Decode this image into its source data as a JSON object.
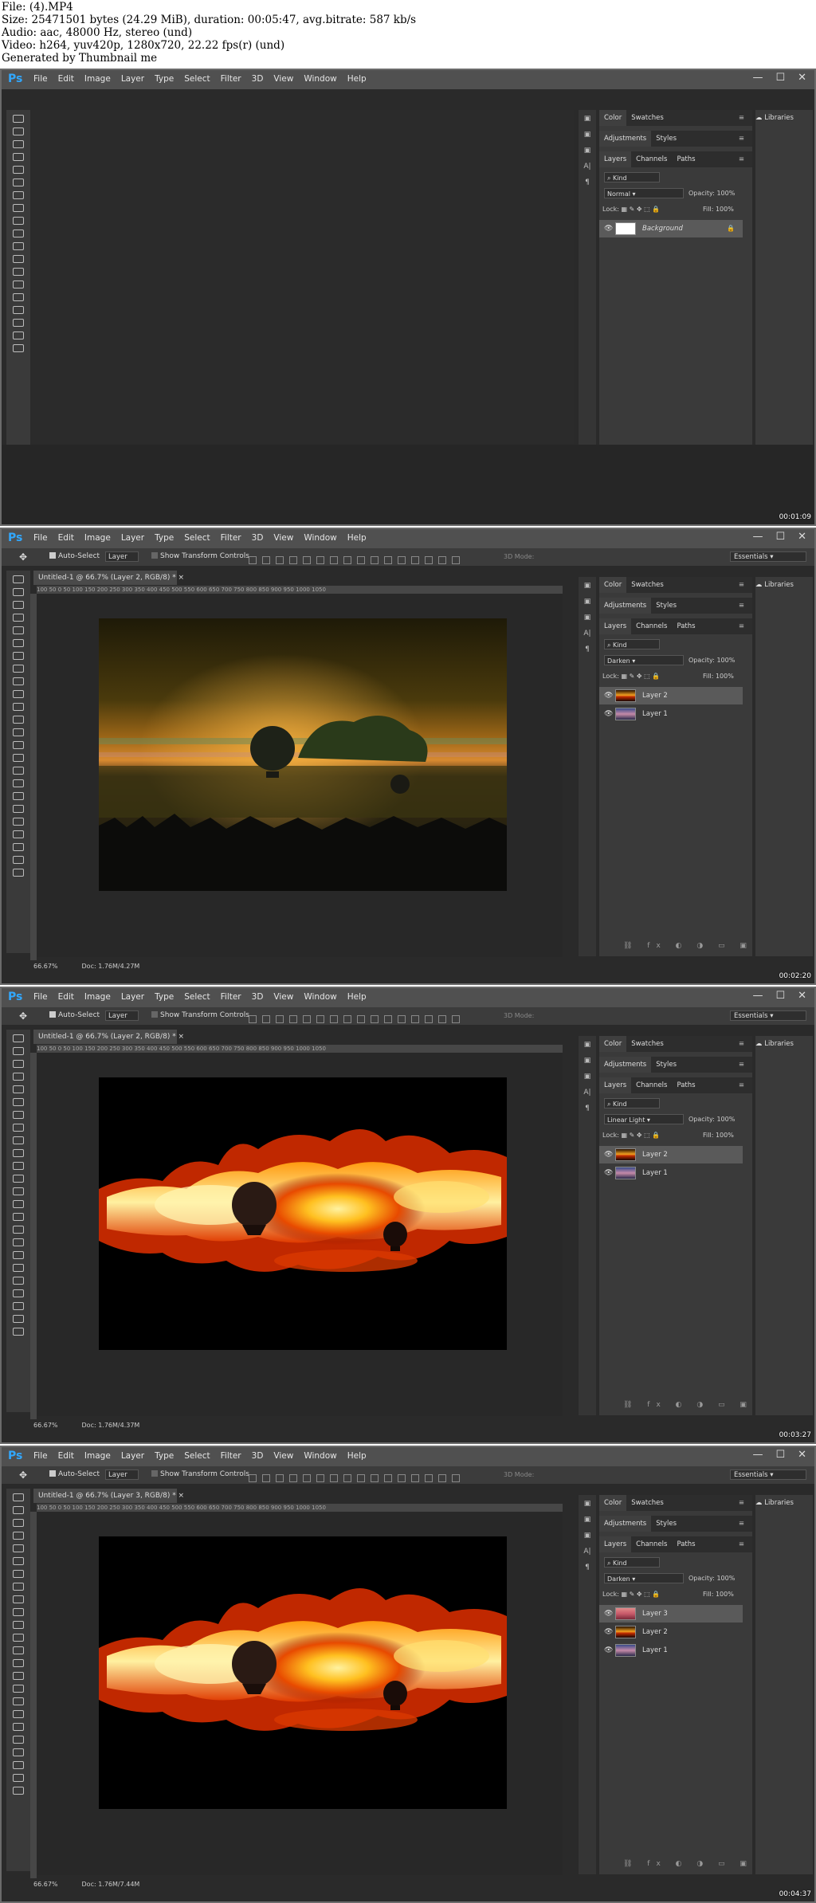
{
  "meta": {
    "file_line": "File:  (4).MP4",
    "size_line": "Size: 25471501 bytes (24.29 MiB), duration: 00:05:47, avg.bitrate: 587 kb/s",
    "audio_line": "Audio: aac, 48000 Hz, stereo (und)",
    "video_line": "Video: h264, yuv420p, 1280x720, 22.22 fps(r) (und)",
    "generated_line": "Generated by Thumbnail me"
  },
  "app": {
    "logo": "Ps",
    "menu": [
      "File",
      "Edit",
      "Image",
      "Layer",
      "Type",
      "Select",
      "Filter",
      "3D",
      "View",
      "Window",
      "Help"
    ],
    "window_buttons": [
      "—",
      "☐",
      "✕"
    ],
    "options": {
      "auto_select": "Auto-Select",
      "layer_select": "Layer",
      "show_transform": "Show Transform Controls",
      "mode_3d": "3D Mode:",
      "workspace": "Essentials"
    },
    "panel_tabs": {
      "color": "Color",
      "swatches": "Swatches",
      "adjustments": "Adjustments",
      "styles": "Styles",
      "layers": "Layers",
      "channels": "Channels",
      "paths": "Paths",
      "libraries": "Libraries",
      "kind": "Kind",
      "opacity_label": "Opacity:",
      "fill_label": "Fill:",
      "lock_label": "Lock:"
    },
    "ruler_ticks": "100  50  0  50  100  150  200  250  300  350  400  450  500  550  600  650  700  750  800  850  900  950  1000  1050"
  },
  "frames": [
    {
      "timestamp": "00:01:09",
      "has_document": false,
      "blend_mode": "Normal",
      "opacity": "100%",
      "fill": "100%",
      "layers": [
        {
          "name": "Background",
          "selected": true,
          "thumb": "white"
        }
      ]
    },
    {
      "timestamp": "00:02:20",
      "has_document": true,
      "doc_tab": "Untitled-1 @ 66.7% (Layer 2, RGB/8) *",
      "zoom": "66.67%",
      "doc_size": "Doc: 1.76M/4.27M",
      "image_style": "darken",
      "blend_mode": "Darken",
      "opacity": "100%",
      "fill": "100%",
      "layers": [
        {
          "name": "Layer 2",
          "selected": true,
          "thumb": "fire"
        },
        {
          "name": "Layer 1",
          "selected": false,
          "thumb": "sky"
        }
      ]
    },
    {
      "timestamp": "00:03:27",
      "has_document": true,
      "doc_tab": "Untitled-1 @ 66.7% (Layer 2, RGB/8) *",
      "zoom": "66.67%",
      "doc_size": "Doc: 1.76M/4.37M",
      "image_style": "fire",
      "blend_mode": "Linear Light",
      "opacity": "100%",
      "fill": "100%",
      "layers": [
        {
          "name": "Layer 2",
          "selected": true,
          "thumb": "fire"
        },
        {
          "name": "Layer 1",
          "selected": false,
          "thumb": "sky"
        }
      ]
    },
    {
      "timestamp": "00:04:37",
      "has_document": true,
      "doc_tab": "Untitled-1 @ 66.7% (Layer 3, RGB/8) *",
      "zoom": "66.67%",
      "doc_size": "Doc: 1.76M/7.44M",
      "image_style": "fire",
      "blend_mode": "Darken",
      "opacity": "100%",
      "fill": "100%",
      "layers": [
        {
          "name": "Layer 3",
          "selected": true,
          "thumb": "pink"
        },
        {
          "name": "Layer 2",
          "selected": false,
          "thumb": "fire"
        },
        {
          "name": "Layer 1",
          "selected": false,
          "thumb": "sky"
        }
      ]
    }
  ]
}
